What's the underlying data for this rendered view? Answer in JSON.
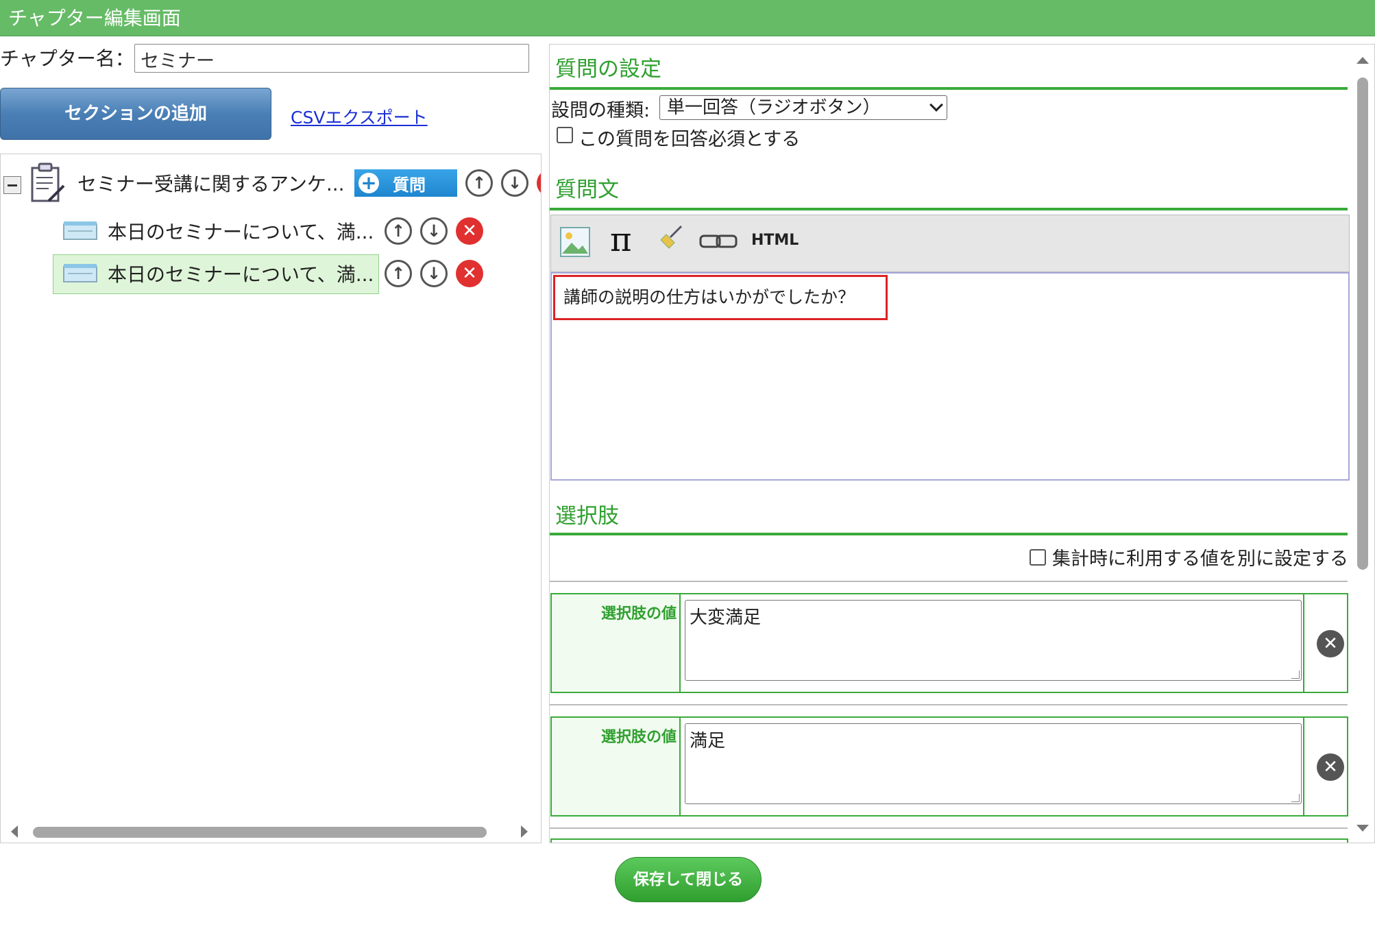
{
  "window": {
    "title": "チャプター編集画面"
  },
  "chapter": {
    "label": "チャプター名：",
    "value": "セミナー"
  },
  "actions": {
    "add_section": "セクションの追加",
    "csv_export": "CSVエクスポート",
    "save_close": "保存して閉じる"
  },
  "tree": {
    "root": {
      "label": "セミナー受講に関するアンケ...",
      "add_question": "質問"
    },
    "items": [
      {
        "label": "本日のセミナーについて、満..."
      },
      {
        "label": "本日のセミナーについて、満...",
        "selected": true
      }
    ]
  },
  "question_settings": {
    "heading": "質問の設定",
    "type_label": "設問の種類:",
    "type_value": "単一回答（ラジオボタン）",
    "required_label": "この質問を回答必須とする",
    "required_checked": false
  },
  "question_text": {
    "heading": "質問文",
    "toolbar": {
      "html_label": "HTML"
    },
    "content": "講師の説明の仕方はいかがでしたか？"
  },
  "choices": {
    "heading": "選択肢",
    "aggregate_label": "集計時に利用する値を別に設定する",
    "aggregate_checked": false,
    "value_label": "選択肢の値",
    "items": [
      {
        "value": "大変満足"
      },
      {
        "value": "満足"
      }
    ]
  },
  "colors": {
    "title_bar": "#66bb66",
    "accent_green": "#2fa02f",
    "add_button_blue": "#4a7fb5",
    "delete_red": "#e03030"
  }
}
